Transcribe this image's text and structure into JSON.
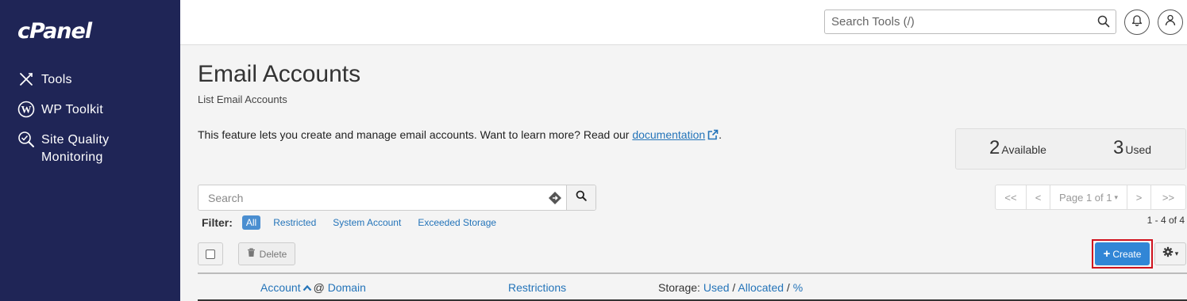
{
  "sidebar": {
    "logo": "cPanel",
    "items": [
      {
        "label": "Tools",
        "icon": "tools-icon"
      },
      {
        "label": "WP Toolkit",
        "icon": "wordpress-icon"
      },
      {
        "label": "Site Quality",
        "label2": "Monitoring",
        "icon": "site-quality-search-icon"
      }
    ]
  },
  "topbar": {
    "search_placeholder": "Search Tools (/)"
  },
  "page": {
    "title": "Email Accounts",
    "subtitle": "List Email Accounts",
    "intro_text": "This feature lets you create and manage email accounts. Want to learn more? Read our ",
    "intro_link": "documentation",
    "intro_end": "."
  },
  "stats": {
    "available_num": "2",
    "available_label": "Available",
    "used_num": "3",
    "used_label": "Used"
  },
  "list": {
    "search_placeholder": "Search",
    "filter_label": "Filter:",
    "filters": [
      "All",
      "Restricted",
      "System Account",
      "Exceeded Storage"
    ],
    "active_filter": "All",
    "pager": {
      "first": "<<",
      "prev": "<",
      "page": "Page 1 of 1",
      "next": ">",
      "last": ">>"
    },
    "range": "1 - 4 of 4",
    "delete_label": "Delete",
    "create_label": "Create"
  },
  "table": {
    "col_account": "Account",
    "col_at": "@",
    "col_domain": "Domain",
    "col_restrictions": "Restrictions",
    "col_storage_label": "Storage:",
    "col_used": "Used",
    "sep1": "/",
    "col_allocated": "Allocated",
    "sep2": "/",
    "col_percent": "%"
  },
  "colors": {
    "sidebar_bg": "#1f2556",
    "link": "#2474b9",
    "primary_button": "#3186d6",
    "highlight_outline": "#d0121d"
  }
}
